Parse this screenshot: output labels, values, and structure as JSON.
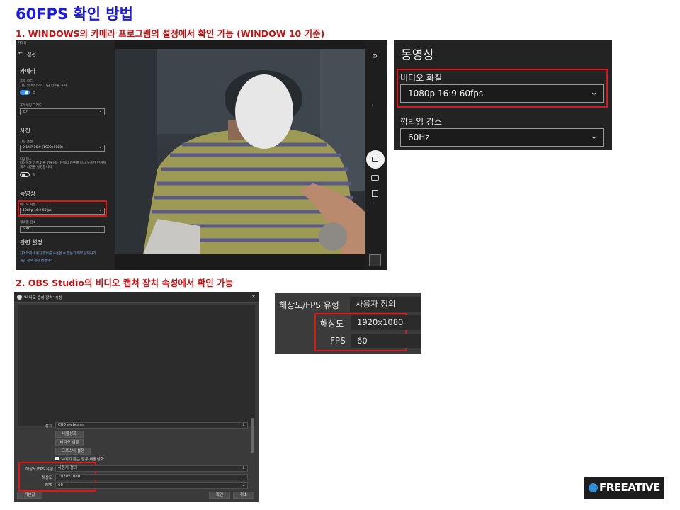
{
  "title": "60FPS 확인 방법",
  "step1": "1. WINDOWS의 카메라 프로그램의 설정에서 확인 가능 (WINDOW 10 기준)",
  "step2": "2. OBS Studio의 비디오 캡쳐 장치 속성에서 확인 가능",
  "camera_app": {
    "window_title": "카메라",
    "back_label": "←",
    "settings_title": "설정",
    "camera_heading": "카메라",
    "pro_mode_label": "프로 모드",
    "pro_mode_desc": "사진 및 비디오의 고급 컨트롤 표시",
    "pro_mode_state": "켬",
    "grid_label": "프레이밍 그리드",
    "grid_value": "끄기",
    "photo_heading": "사진",
    "photo_quality_label": "사진 품질",
    "photo_quality_value": "2.1MP 16:9 (1920x1080)",
    "timelapse_label": "타임랩스",
    "timelapse_desc": "타이머가 켜져 있을 경우에는 카메라 단추를 다시 누르기 전까지 계속 사진을 촬영합니다.",
    "timelapse_state": "끔",
    "video_heading": "동영상",
    "video_quality_label": "비디오 화질",
    "video_quality_value": "1080p 16:9 60fps",
    "flicker_label": "깜박임 감소",
    "flicker_value": "60Hz",
    "related_heading": "관련 설정",
    "link1": "카메라에서 위치 정보를 사용할 수 있는지 여부 선택하기",
    "link2": "개인 정보 설정 변경하기"
  },
  "zoom_camera": {
    "heading": "동영상",
    "video_quality_label": "비디오 화질",
    "video_quality_value": "1080p 16:9 60fps",
    "flicker_label": "깜박임 감소",
    "flicker_value": "60Hz"
  },
  "obs": {
    "window_title": "'비디오 캡쳐 장치' 속성",
    "device_label": "장치",
    "device_value": "C80 webcam",
    "btn_deactivate": "비활성화",
    "btn_video_settings": "비디오 설정",
    "btn_crossbar": "크로스바 설정",
    "checkbox_label": "보이지 않는 경우 비활성화",
    "res_type_label": "해상도/FPS 유형",
    "res_type_value": "사용자 정의",
    "resolution_label": "해상도",
    "resolution_value": "1920x1080",
    "fps_label": "FPS",
    "fps_value": "60",
    "defaults_button": "기본값",
    "ok_button": "확인",
    "cancel_button": "취소"
  },
  "zoom_obs": {
    "res_type_label": "해상도/FPS 유형",
    "res_type_value": "사용자 정의",
    "resolution_label": "해상도",
    "resolution_value": "1920x1080",
    "fps_label": "FPS",
    "fps_value": "60"
  },
  "logo_text": "FREEATIVE",
  "colors": {
    "title": "#1a1ae0",
    "subtitle": "#cc1010",
    "highlight": "#e01616",
    "toggle_on": "#3a8ee6"
  }
}
